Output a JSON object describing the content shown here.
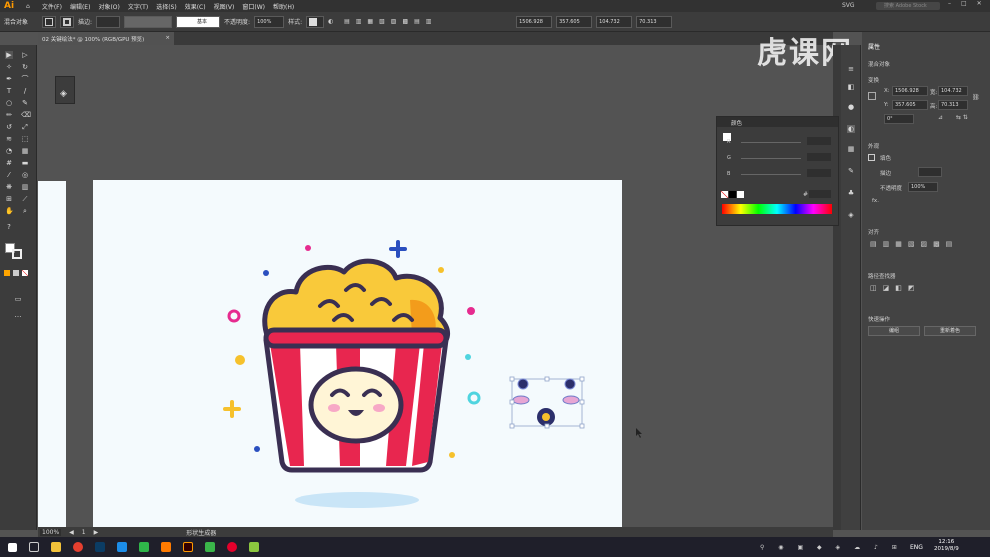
{
  "app": {
    "logo": "Ai",
    "workspace": "SVG",
    "search_placeholder": "搜索 Adobe Stock"
  },
  "menus": [
    "文件(F)",
    "编辑(E)",
    "对象(O)",
    "文字(T)",
    "选择(S)",
    "效果(C)",
    "视图(V)",
    "窗口(W)",
    "帮助(H)"
  ],
  "control_bar": {
    "selection_label": "混合对象",
    "stroke_label": "描边:",
    "stroke_style": "基本",
    "opacity_label": "不透明度:",
    "opacity_value": "100%",
    "style_label": "样式:",
    "x_value": "1506.928",
    "y_value": "357.605",
    "w_value": "104.732",
    "h_value": "70.313"
  },
  "tab": {
    "title": "02 关键绘法* @ 100% (RGB/GPU 预览)",
    "close": "×"
  },
  "status": {
    "zoom": "100%",
    "page": "1",
    "mode": "形状生成器"
  },
  "watermark": "虎课网",
  "color_panel": {
    "title": "颜色",
    "sliders": [
      {
        "label": "R"
      },
      {
        "label": "G"
      },
      {
        "label": "B"
      }
    ],
    "hex_label": "#"
  },
  "properties": {
    "title": "属性",
    "subtitle": "混合对象",
    "transform_title": "变换",
    "x_label": "X:",
    "x": "1506.928",
    "y_label": "Y:",
    "y": "357.605",
    "w_label": "宽:",
    "w": "104.732",
    "h_label": "高:",
    "h": "70.313",
    "angle": "0°",
    "appearance_title": "外观",
    "fill_label": "填色",
    "stroke_label": "描边",
    "opacity_label": "不透明度",
    "opacity": "100%",
    "fx": "fx.",
    "align_title": "对齐",
    "pathfinder_title": "路径查找器",
    "quick_actions_title": "快速操作",
    "btn_edit": "编组",
    "btn_recolor": "重新着色"
  },
  "taskbar": {
    "lang": "ENG",
    "time": "12:16",
    "date": "2019/8/9"
  }
}
